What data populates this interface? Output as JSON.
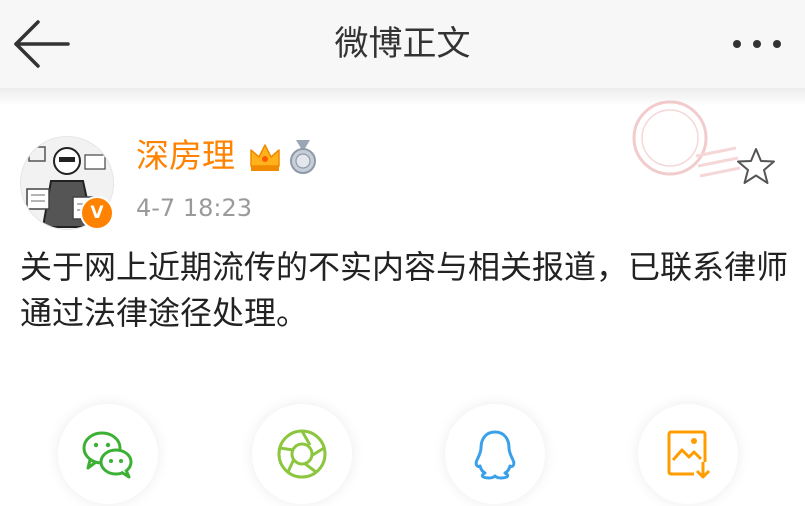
{
  "navbar": {
    "title": "微博正文",
    "back_icon": "arrow-left-icon",
    "more_icon": "more-dots-icon"
  },
  "post": {
    "author": {
      "name": "深房理",
      "verified_badge_text": "V",
      "name_color": "#ff8200",
      "badges": [
        "crown-icon",
        "medal-icon"
      ]
    },
    "time": "4-7 18:23",
    "text": "关于网上近期流传的不实内容与相关报道，已联系律师通过法律途径处理。",
    "favorite_icon": "star-outline-icon"
  },
  "share": {
    "buttons": [
      {
        "name": "wechat",
        "icon": "wechat-icon",
        "color": "#3cb034"
      },
      {
        "name": "moments",
        "icon": "moments-icon",
        "color": "#8cc63f"
      },
      {
        "name": "qq",
        "icon": "qq-icon",
        "color": "#3aa0ea"
      },
      {
        "name": "save-image",
        "icon": "save-image-icon",
        "color": "#ff9c00"
      }
    ]
  }
}
